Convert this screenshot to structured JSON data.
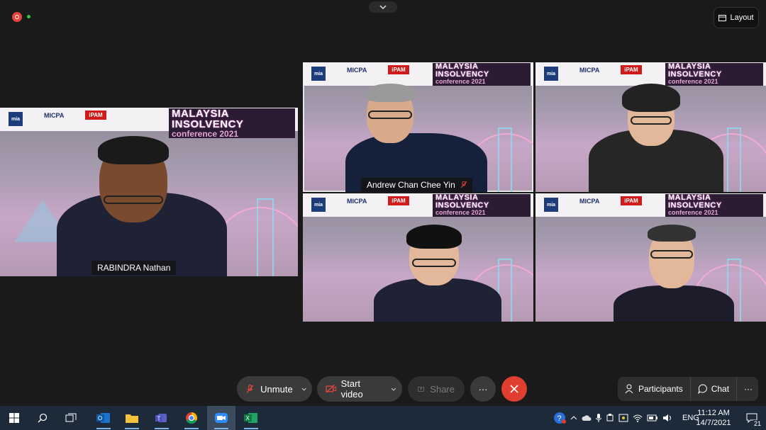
{
  "window": {
    "layout_label": "Layout",
    "icons": {
      "record": "record-icon",
      "encryption": "green-dot-icon",
      "collapse": "chevron-down-icon",
      "layout": "layout-icon"
    }
  },
  "banner": {
    "line1": "MALAYSIA",
    "line2": "INSOLVENCY",
    "line3": "conference 2021",
    "logo_mia": "mia",
    "logo_micpa": "MICPA",
    "logo_ipam": "iPAM"
  },
  "participants": [
    {
      "name": "RABINDRA Nathan",
      "muted": false
    },
    {
      "name": "Andrew Chan Chee Yin",
      "muted": true
    },
    {
      "name": "",
      "muted": false
    },
    {
      "name": "",
      "muted": false
    },
    {
      "name": "",
      "muted": false
    }
  ],
  "toolbar": {
    "unmute_label": "Unmute",
    "start_video_label": "Start video",
    "share_label": "Share",
    "more_label": "···",
    "participants_label": "Participants",
    "chat_label": "Chat",
    "right_more_label": "···"
  },
  "taskbar": {
    "apps": [
      "windows-start",
      "search",
      "task-view",
      "outlook",
      "file-explorer",
      "teams",
      "chrome",
      "zoom",
      "excel"
    ],
    "language": "ENG",
    "time": "11:12 AM",
    "date": "14/7/2021",
    "notification_count": "21"
  },
  "colors": {
    "accent_red": "#e03e2f",
    "background": "#1a1a1a",
    "taskbar": "#1c2a3a"
  }
}
